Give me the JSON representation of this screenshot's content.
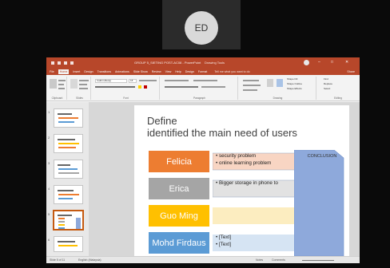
{
  "participant": {
    "initials": "ED"
  },
  "powerpoint": {
    "title_bar": {
      "document_title": "GROUP 5_SIETING POST-AC08 - PowerPoint",
      "contextual_tab": "Drawing Tools",
      "minimize": "–",
      "restore": "□",
      "close": "✕"
    },
    "tabs": [
      "File",
      "Home",
      "Insert",
      "Design",
      "Transitions",
      "Animations",
      "Slide Show",
      "Review",
      "View",
      "Help",
      "Design",
      "Format"
    ],
    "tell_me": "Tell me what you want to do",
    "share": "Share",
    "ribbon_groups": [
      "Clipboard",
      "Slides",
      "Font",
      "Paragraph",
      "Drawing",
      "Editing"
    ],
    "ribbon_buttons": {
      "paste": "Paste",
      "new_slide": "New Slide",
      "font_name": "Calibri (Body)",
      "font_size": "18",
      "shape_fill": "Shape Fill",
      "shape_outline": "Shape Outline",
      "shape_effects": "Shape Effects",
      "find": "Find",
      "replace": "Replace",
      "select": "Select"
    },
    "thumbnails": [
      "1",
      "2",
      "3",
      "4",
      "5",
      "6"
    ],
    "status_bar": {
      "slide_info": "Slide 5 of 11",
      "language": "English (Malaysia)",
      "notes": "Notes",
      "comments": "Comments"
    }
  },
  "slide": {
    "title_line1": "Define",
    "title_line2": "identified the main need of users",
    "rows": [
      {
        "name": "Felicia",
        "color": "#ED7D31",
        "bullets": [
          "security problem",
          "online learning problem"
        ]
      },
      {
        "name": "Erica",
        "color": "#A5A5A5",
        "bullets": [
          "Bigger storage in phone to"
        ]
      },
      {
        "name": "Guo Ming",
        "color": "#FFC000",
        "bullets": []
      },
      {
        "name": "Mohd Firdaus",
        "color": "#5B9BD5",
        "bullets": [
          "[Text]",
          "[Text]"
        ]
      }
    ],
    "conclusion_label": "CONCLUSION",
    "conclusion_color": "#8EA9DB"
  }
}
